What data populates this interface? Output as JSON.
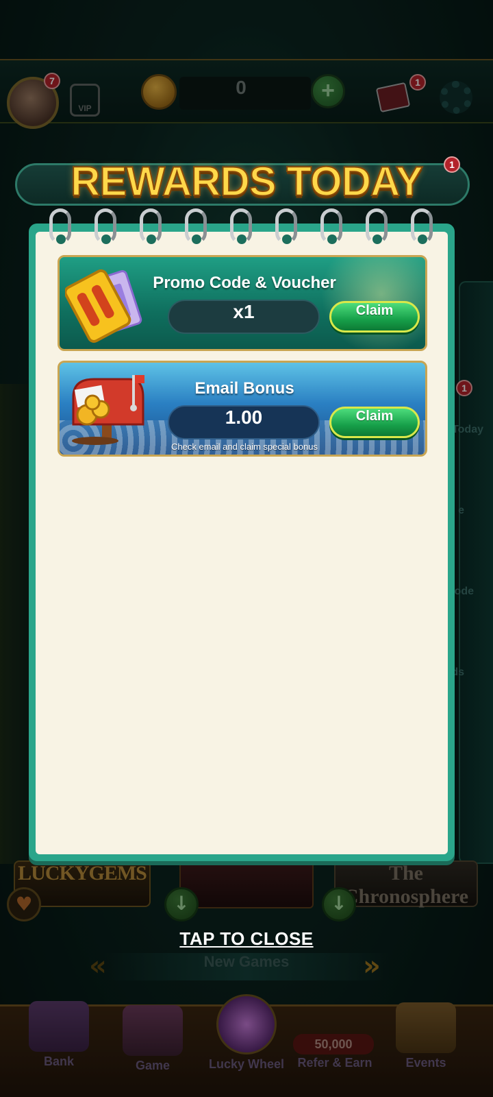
{
  "header": {
    "avatar_badge": "7",
    "vip_label": "VIP",
    "coin_balance": "0",
    "mail_badge": "1"
  },
  "side_menu": {
    "items": [
      "Today",
      "e",
      "ode",
      "ds"
    ],
    "badge": "1"
  },
  "games": {
    "left_title": "LUCKYGEMS",
    "right_title": "The Chronosphere"
  },
  "new_games_label": "New Games",
  "bottom_nav": {
    "items": [
      {
        "label": "Bank"
      },
      {
        "label": "Game"
      },
      {
        "label": "Lucky Wheel"
      },
      {
        "label": "Refer & Earn"
      },
      {
        "label": "Events"
      }
    ],
    "refer_amount": "50,000"
  },
  "modal": {
    "title": "REWARDS TODAY",
    "title_badge": "1",
    "rewards": [
      {
        "title": "Promo Code & Voucher",
        "value": "x1",
        "claim_label": "Claim",
        "subtitle": ""
      },
      {
        "title": "Email Bonus",
        "value": "1.00",
        "claim_label": "Claim",
        "subtitle": "Check email and claim special bonus"
      }
    ],
    "close_label": "TAP TO CLOSE"
  },
  "colors": {
    "title_gold": "#ffd84a",
    "notebook_teal": "#2aa58a",
    "paper": "#f8f3e4",
    "claim_green": "#17a04a"
  }
}
